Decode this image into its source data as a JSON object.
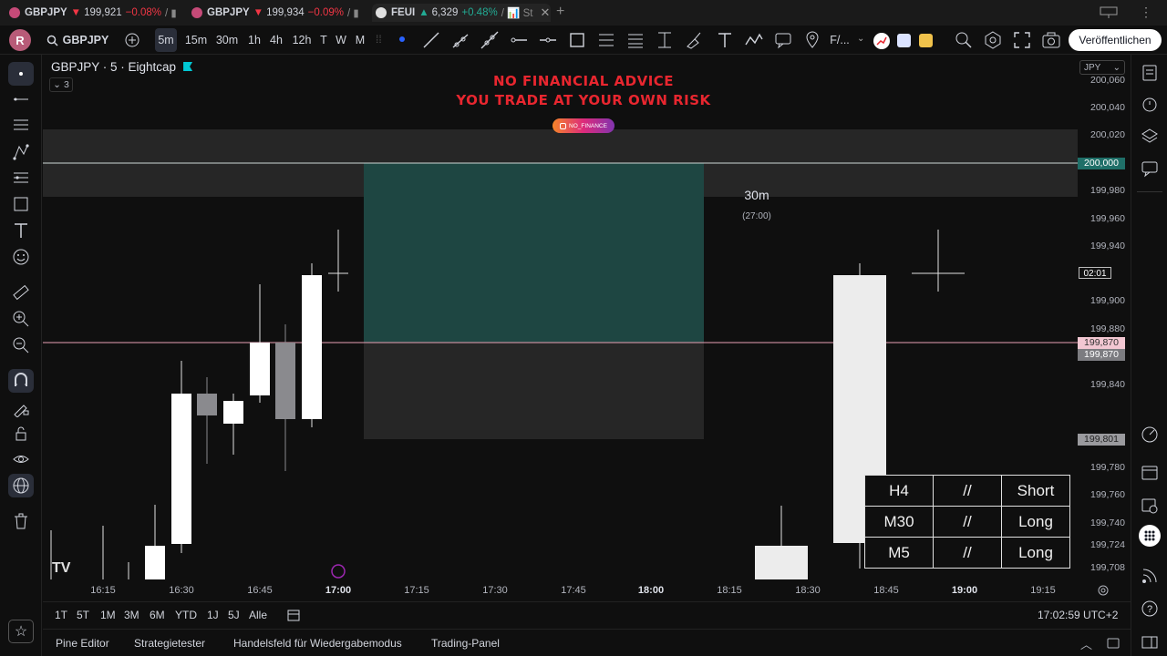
{
  "browser_tabs": [
    {
      "symbol": "GBPJPY",
      "direction": "▼",
      "price": "199,921",
      "change": "−0.08%",
      "trail": "/ ▮"
    },
    {
      "symbol": "GBPJPY",
      "direction": "▼",
      "price": "199,934",
      "change": "−0.09%",
      "trail": "/ ▮"
    },
    {
      "symbol": "FEUI",
      "direction": "▲",
      "price": "6,329",
      "change": "+0.48%",
      "trail": "/ 📊 St",
      "close": "✕"
    }
  ],
  "new_tab": "+",
  "toolbar": {
    "avatar": "R",
    "symbol": "GBPJPY",
    "intervals": [
      "5m",
      "15m",
      "30m",
      "1h",
      "4h",
      "12h",
      "T",
      "W",
      "M"
    ],
    "selected_interval": "5m",
    "text_tool_label": "F/...",
    "publish_label": "Veröffentlichen"
  },
  "chart": {
    "symbol_title": "GBPJPY · 5 · Eightcap",
    "legend_count": "3",
    "warning_line1": "NO FINANCIAL ADVICE",
    "warning_line2": "YOU TRADE AT YOUR OWN RISK",
    "instagram_handle": "NO_FINANCE",
    "timeframe_label": "30m",
    "countdown": "(27:00)",
    "currency": "JPY",
    "price_labels": [
      "200,060",
      "200,040",
      "200,020",
      "199,980",
      "199,960",
      "199,940",
      "199,900",
      "199,880",
      "199,840",
      "199,780",
      "199,760",
      "199,740",
      "199,724",
      "199,708"
    ],
    "tags": {
      "level_white": "200,000",
      "countdown_tag": "02:01",
      "level_pink": "199,870",
      "current": "199,870",
      "lower": "199,801"
    },
    "time_labels": [
      "16:15",
      "16:30",
      "16:45",
      "17:00",
      "17:15",
      "17:30",
      "17:45",
      "18:00",
      "18:15",
      "18:30",
      "18:45",
      "19:00",
      "19:15"
    ],
    "bold_times": [
      "17:00",
      "18:00",
      "19:00"
    ]
  },
  "bias_table": [
    [
      "H4",
      "//",
      "Short"
    ],
    [
      "M30",
      "//",
      "Long"
    ],
    [
      "M5",
      "//",
      "Long"
    ]
  ],
  "range_bar": {
    "ranges": [
      "1T",
      "5T",
      "1M",
      "3M",
      "6M",
      "YTD",
      "1J",
      "5J",
      "Alle"
    ],
    "clock": "17:02:59 UTC+2"
  },
  "bottom_tabs": [
    "Pine Editor",
    "Strategietester",
    "Handelsfeld für Wiedergabemodus",
    "Trading-Panel"
  ],
  "colors": {
    "background": "#0f0f0f",
    "warning_red": "#e8262f",
    "teal_zone": "#1f4a46",
    "gray_zone": "#2a2a2a",
    "pink_line": "#e8a0b4",
    "up_candle": "#ffffff",
    "down_candle": "#8a8a8e"
  }
}
